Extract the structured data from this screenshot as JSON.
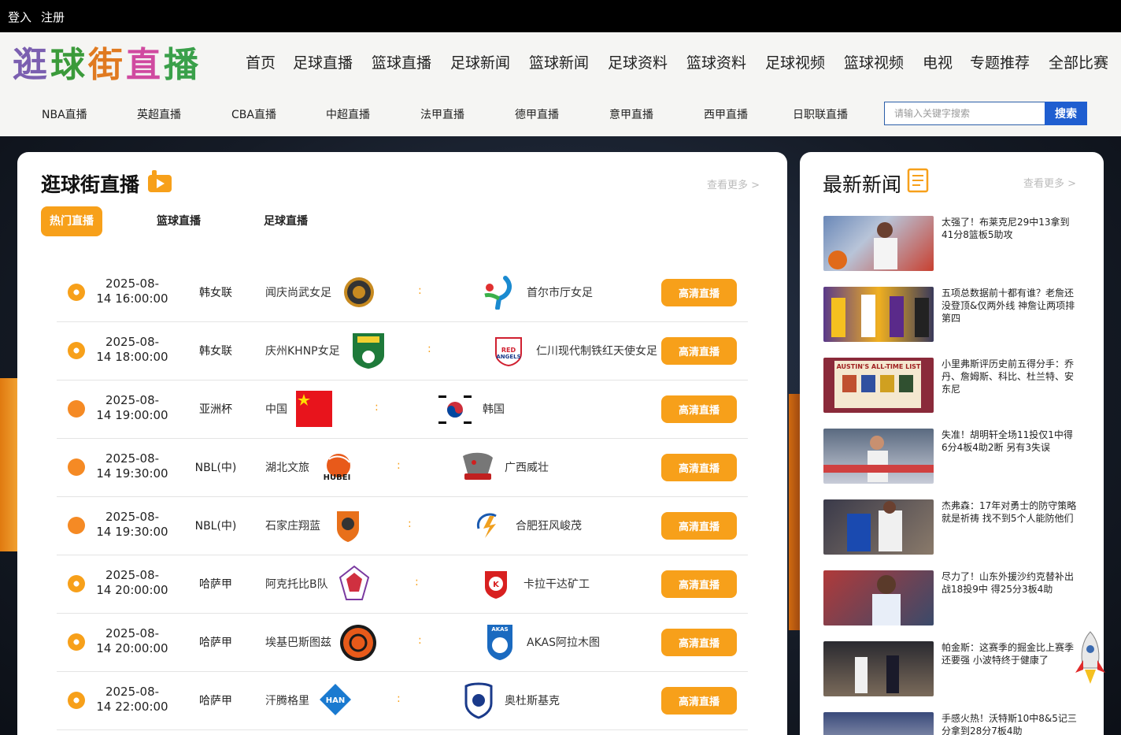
{
  "topbar": {
    "login": "登入",
    "register": "注册"
  },
  "logo": {
    "text": "逛球街直播",
    "colors": [
      "#7b5fb0",
      "#3a9a3a",
      "#e07a20",
      "#d04aa0",
      "#3aa04a"
    ]
  },
  "nav": {
    "main": [
      "首页",
      "足球直播",
      "篮球直播",
      "足球新闻",
      "篮球新闻",
      "足球资料",
      "篮球资料",
      "足球视频",
      "篮球视频",
      "电视",
      "专题推荐",
      "全部比赛"
    ],
    "sub": [
      "NBA直播",
      "英超直播",
      "CBA直播",
      "中超直播",
      "法甲直播",
      "德甲直播",
      "意甲直播",
      "西甲直播",
      "日职联直播"
    ]
  },
  "search": {
    "placeholder": "请输入关键字搜索",
    "button": "搜索"
  },
  "live": {
    "title": "逛球街直播",
    "more": "查看更多 >",
    "tabs": [
      "热门直播",
      "篮球直播",
      "足球直播"
    ],
    "button_label": "高清直播",
    "colon": ":",
    "matches": [
      {
        "sport": "soccer",
        "date": "2025-08-",
        "time": "14 16:00:00",
        "league": "韩女联",
        "home": "闻庆尚武女足",
        "away": "首尔市厅女足"
      },
      {
        "sport": "soccer",
        "date": "2025-08-",
        "time": "14 18:00:00",
        "league": "韩女联",
        "home": "庆州KHNP女足",
        "away": "仁川现代制铁红天使女足"
      },
      {
        "sport": "basketball",
        "date": "2025-08-",
        "time": "14 19:00:00",
        "league": "亚洲杯",
        "home": "中国",
        "away": "韩国"
      },
      {
        "sport": "basketball",
        "date": "2025-08-",
        "time": "14 19:30:00",
        "league": "NBL(中)",
        "home": "湖北文旅",
        "away": "广西威壮"
      },
      {
        "sport": "basketball",
        "date": "2025-08-",
        "time": "14 19:30:00",
        "league": "NBL(中)",
        "home": "石家庄翔蓝",
        "away": "合肥狂风峻茂"
      },
      {
        "sport": "soccer",
        "date": "2025-08-",
        "time": "14 20:00:00",
        "league": "哈萨甲",
        "home": "阿克托比B队",
        "away": "卡拉干达矿工"
      },
      {
        "sport": "soccer",
        "date": "2025-08-",
        "time": "14 20:00:00",
        "league": "哈萨甲",
        "home": "埃基巴斯图兹",
        "away": "AKAS阿拉木图"
      },
      {
        "sport": "soccer",
        "date": "2025-08-",
        "time": "14 22:00:00",
        "league": "哈萨甲",
        "home": "汗腾格里",
        "away": "奥杜斯基克"
      }
    ],
    "logo_texts": {
      "hubei": "HUBEI",
      "akas": "AKAS",
      "han": "HAN",
      "red_angels": "RED ANGELS"
    }
  },
  "news": {
    "title": "最新新闻",
    "more": "查看更多 >",
    "items": [
      "太强了！布莱克尼29中13拿到41分8篮板5助攻",
      "五项总数据前十都有谁？老詹还没登顶&仅两外线 神詹让两项排第四",
      "小里弗斯评历史前五得分手：乔丹、詹姆斯、科比、杜兰特、安东尼",
      "失准！胡明轩全场11投仅1中得6分4板4助2断 另有3失误",
      "杰弗森：17年对勇士的防守策略就是祈祷 找不到5个人能防他们",
      "尽力了！山东外援沙约克替补出战18投9中 得25分3板4助",
      "帕金斯：这赛季的掘金比上赛季还要强 小波特终于健康了",
      "手感火热！沃特斯10中8&5记三分拿到28分7板4助"
    ],
    "thumb3_caption": "AUSTIN'S ALL-TIME LIST"
  }
}
